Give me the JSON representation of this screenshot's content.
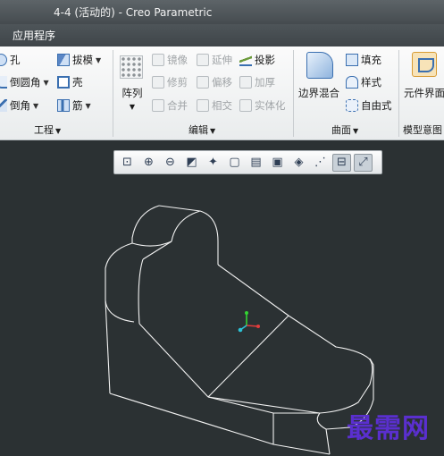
{
  "window": {
    "title": "4-4 (活动的) - Creo Parametric"
  },
  "ribbon_tabs": {
    "active": "应用程序"
  },
  "ribbon": {
    "engineering": {
      "label": "工程",
      "hole": "孔",
      "round": "倒圆角",
      "chamfer": "倒角",
      "draft": "拔模",
      "shell": "壳",
      "rib": "筋"
    },
    "array": {
      "label": "阵列"
    },
    "editing": {
      "label": "编辑",
      "mirror": "镜像",
      "extend": "延伸",
      "project": "投影",
      "trim": "修剪",
      "offset": "偏移",
      "thicken": "加厚",
      "merge": "合并",
      "intersect": "相交",
      "solidify": "实体化"
    },
    "surfaces": {
      "label": "曲面",
      "boundary_blend": "边界混合",
      "fill": "填充",
      "style": "样式",
      "freestyle": "自由式"
    },
    "model_intent": {
      "label": "模型意图",
      "component_interface": "元件界面"
    }
  },
  "graphics_toolbar": {
    "buttons": [
      "zoom-fit-icon",
      "zoom-in-icon",
      "zoom-out-icon",
      "repaint-icon",
      "spin-center-icon",
      "view-cube-icon",
      "saved-views-icon",
      "display-style-icon",
      "datum-display-icon",
      "annotation-icon",
      "csys-toggle-icon",
      "hidden-line-icon"
    ]
  },
  "watermark": "最需网"
}
